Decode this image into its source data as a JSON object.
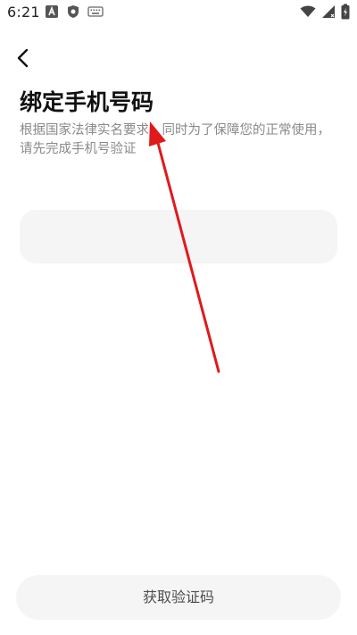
{
  "status_bar": {
    "time": "6:21",
    "left_icons": [
      "notification-a-icon",
      "shield-icon",
      "keyboard-icon"
    ],
    "right_icons": [
      "wifi-icon",
      "signal-icon",
      "battery-charging-icon"
    ]
  },
  "header": {
    "back_icon": "chevron-left-icon"
  },
  "main": {
    "title": "绑定手机号码",
    "subtitle": "根据国家法律实名要求，同时为了保障您的正常使用，请先完成手机号验证",
    "phone_input": {
      "value": "",
      "placeholder": ""
    }
  },
  "footer": {
    "get_code_label": "获取验证码"
  },
  "annotation": {
    "type": "arrow",
    "color": "#e0191b"
  }
}
